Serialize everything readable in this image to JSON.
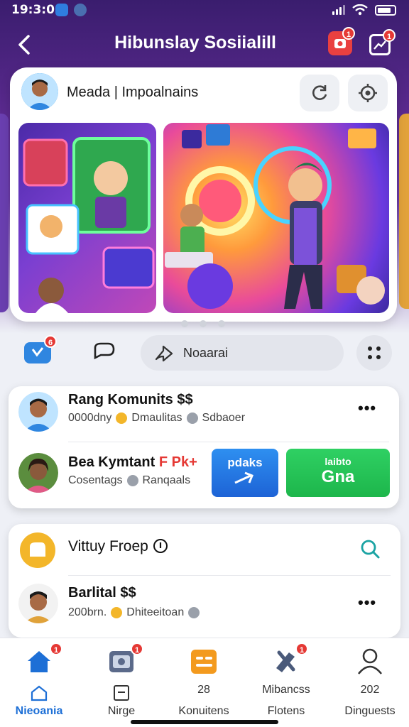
{
  "status_bar": {
    "time": "19:3:0"
  },
  "header": {
    "title": "Hibunslay Sosiialill",
    "badge_1": "1",
    "badge_2": "1"
  },
  "featured": {
    "title": "Meada | Impoalnains"
  },
  "actions": {
    "chat_badge": "6",
    "search_placeholder": "Noaarai"
  },
  "community_list": [
    {
      "name": "Rang Komunits",
      "name_suffix": "$$",
      "time": "0000dny",
      "meta1": "Dmaulitas",
      "meta2": "Sdbaoer"
    },
    {
      "name": "Bea Kymtant",
      "name_suffix": "F Pk+",
      "time": "Cosentags",
      "meta2": "Ranqaals"
    }
  ],
  "tiles": {
    "blue_label": "pdaks",
    "green_label": "laibto",
    "green_big": "Gna"
  },
  "second_card": {
    "title": "Vittuy Froep",
    "row": {
      "name": "Barlital",
      "name_suffix": "$$",
      "time": "200brn.",
      "meta": "Dhiteeitoan"
    }
  },
  "bottom_nav": [
    {
      "label": "Nieoania",
      "sub": "",
      "active": true,
      "badge": "1"
    },
    {
      "label": "Nirge",
      "sub": "",
      "active": false,
      "badge": "1"
    },
    {
      "label": "Konuitens",
      "sub": "28",
      "active": false,
      "badge": ""
    },
    {
      "label": "Flotens",
      "sub": "Mibancss",
      "active": false,
      "badge": "1"
    },
    {
      "label": "Dinguests",
      "sub": "202",
      "active": false,
      "badge": ""
    }
  ],
  "colors": {
    "brand_purple": "#5b2a8f",
    "accent_blue": "#1d6fd6",
    "accent_green": "#1db64b",
    "badge_red": "#e53935"
  }
}
